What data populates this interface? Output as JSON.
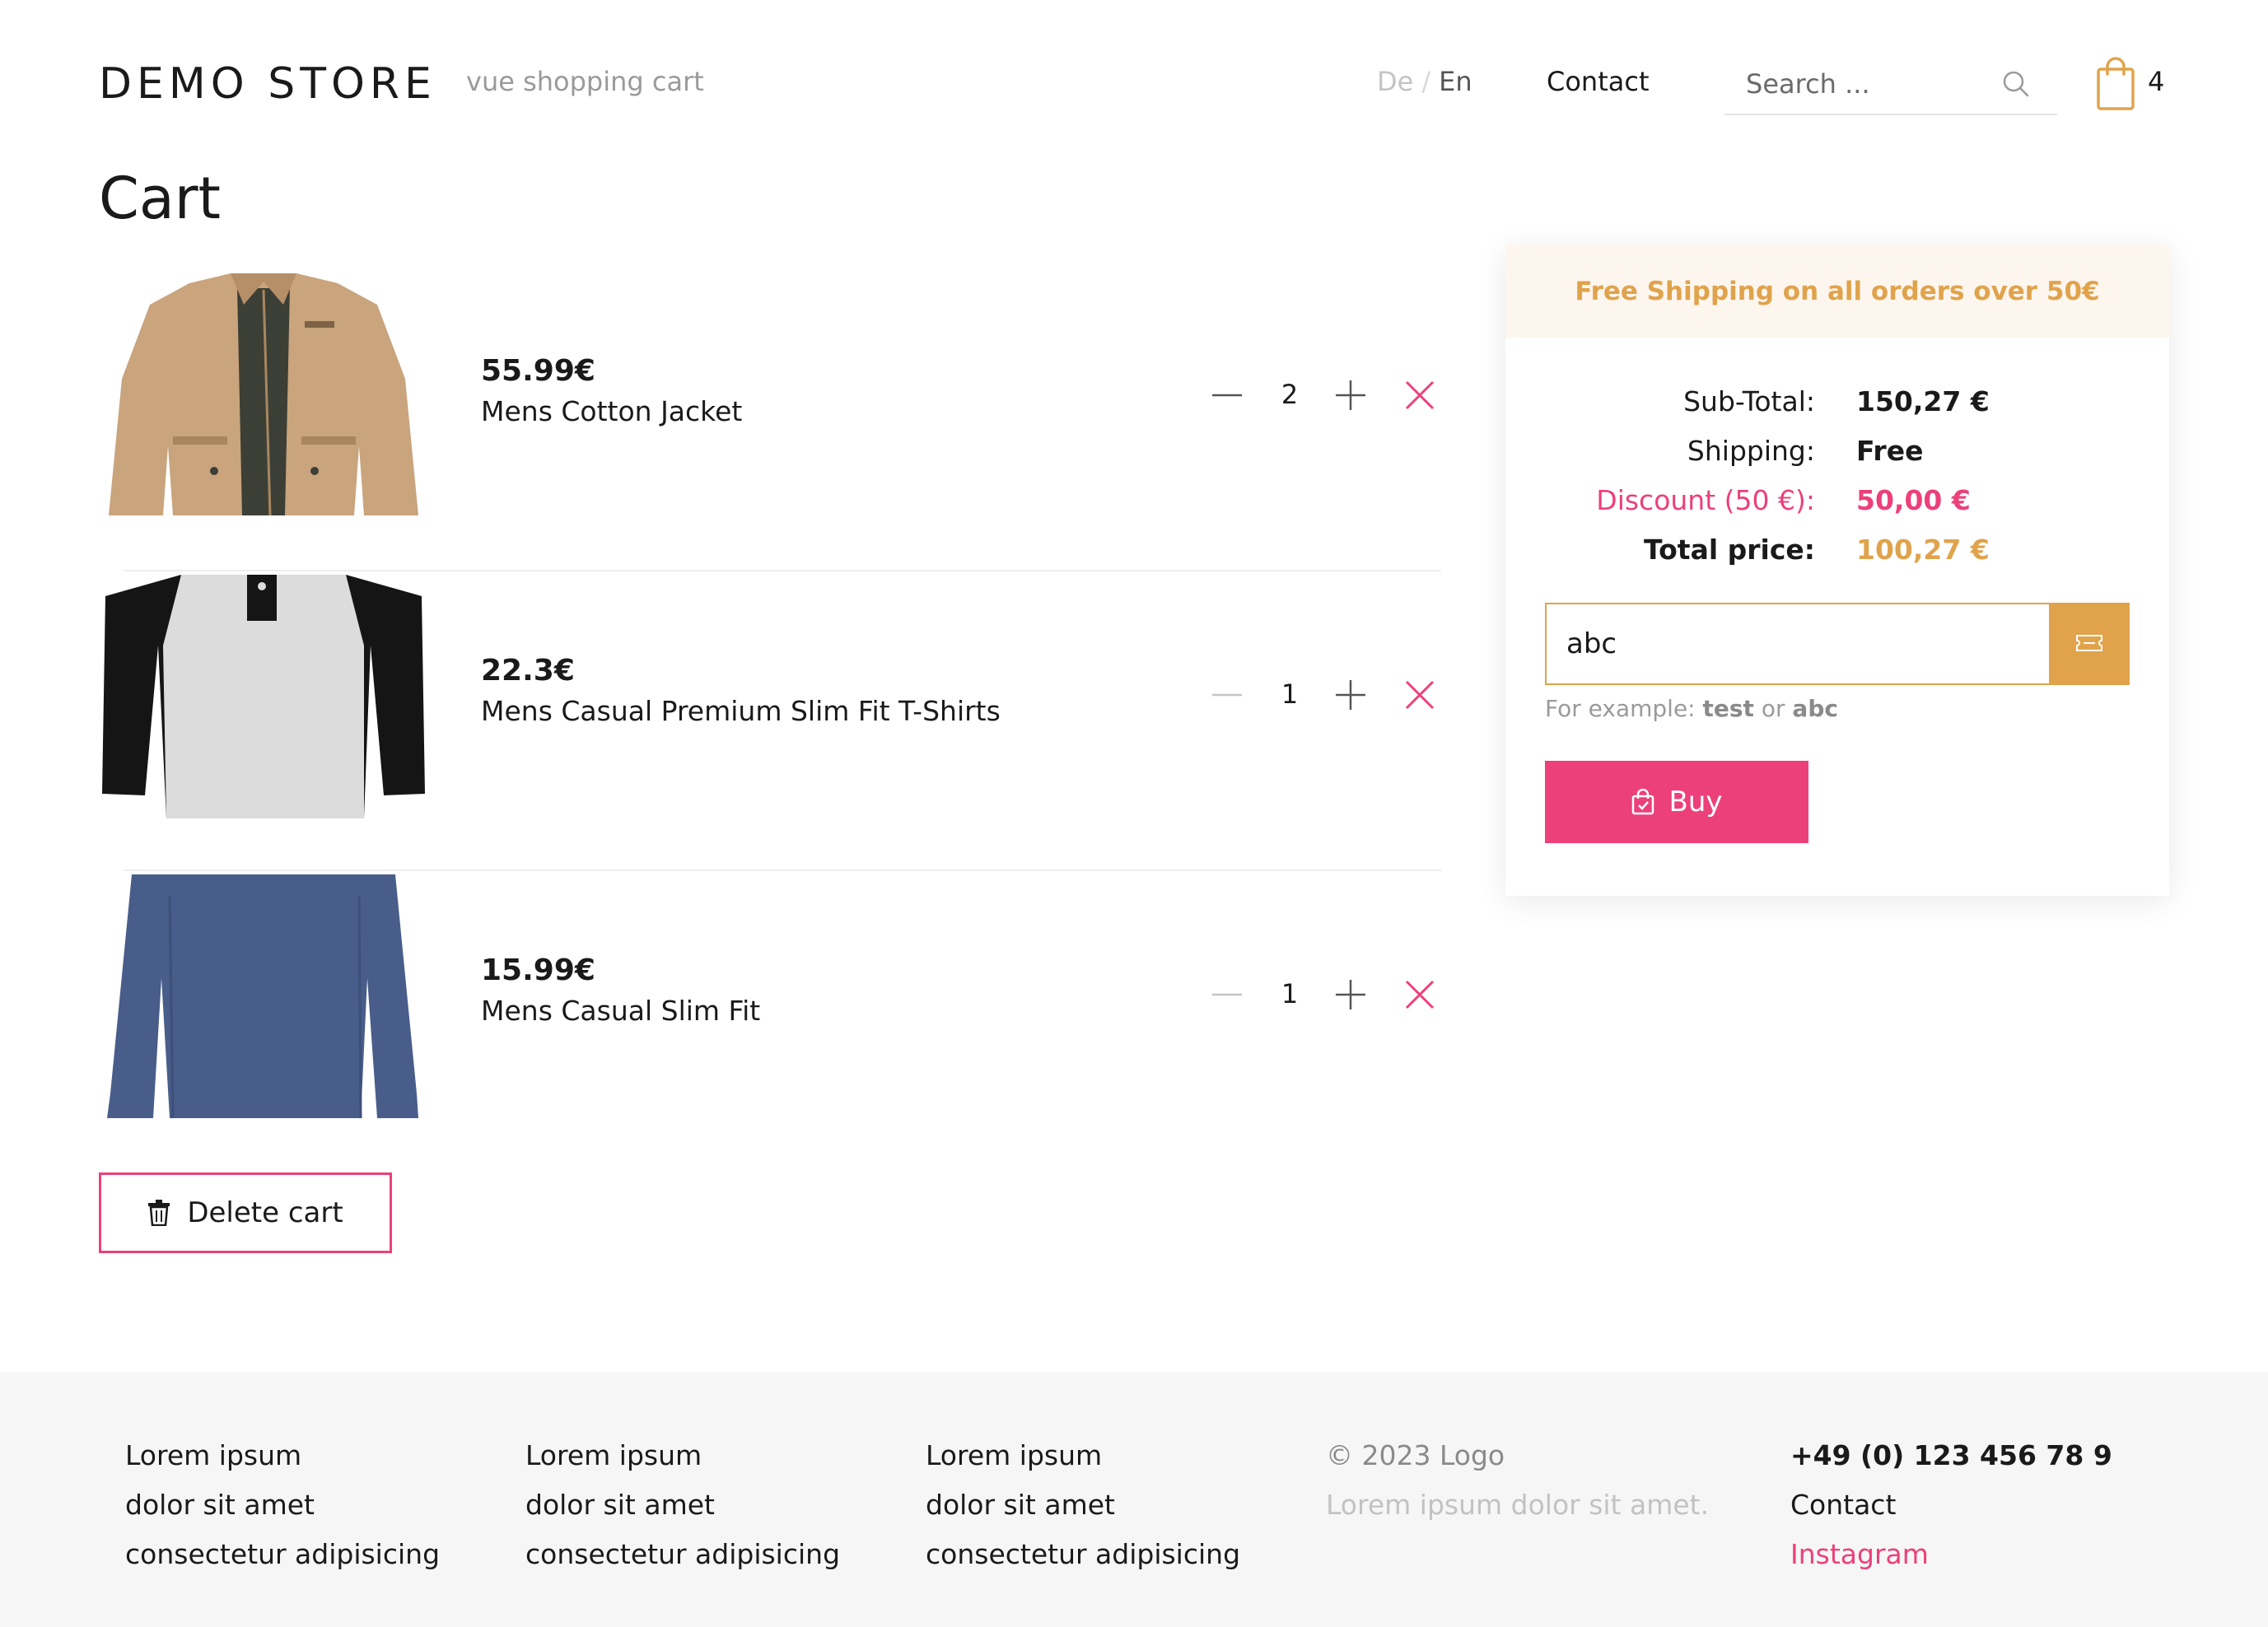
{
  "header": {
    "brand": "DEMO STORE",
    "tagline": "vue shopping cart",
    "lang_de": "De",
    "lang_sep": "/",
    "lang_en": "En",
    "contact": "Contact",
    "search_placeholder": "Search ...",
    "cart_count": "4"
  },
  "page_title": "Cart",
  "cart_items": [
    {
      "price": "55.99€",
      "name": "Mens Cotton Jacket",
      "qty": "2",
      "image": "jacket"
    },
    {
      "price": "22.3€",
      "name": "Mens Casual Premium Slim Fit T-Shirts",
      "qty": "1",
      "image": "raglan-tshirt"
    },
    {
      "price": "15.99€",
      "name": "Mens Casual Slim Fit",
      "qty": "1",
      "image": "longsleeve-shirt"
    }
  ],
  "delete_cart_label": "Delete cart",
  "summary": {
    "shipping_banner": "Free Shipping on all orders over 50€",
    "subtotal_label": "Sub-Total:",
    "subtotal_value": "150,27 €",
    "shipping_label": "Shipping:",
    "shipping_value": "Free",
    "discount_label": "Discount (50 €):",
    "discount_value": "50,00 €",
    "total_label": "Total price:",
    "total_value": "100,27 €",
    "coupon_value": "abc",
    "hint_prefix": "For example:",
    "hint_code1": "test",
    "hint_or": "or",
    "hint_code2": "abc",
    "buy_label": "Buy"
  },
  "footer": {
    "col1": [
      "Lorem ipsum",
      "dolor sit amet",
      "consectetur adipisicing"
    ],
    "col2": [
      "Lorem ipsum",
      "dolor sit amet",
      "consectetur adipisicing"
    ],
    "col3": [
      "Lorem ipsum",
      "dolor sit amet",
      "consectetur adipisicing"
    ],
    "copyright": "© 2023 Logo",
    "tagline": "Lorem ipsum dolor sit amet.",
    "phone": "+49 (0) 123 456 78 9",
    "contact": "Contact",
    "instagram": "Instagram"
  },
  "colors": {
    "accent_pink": "#ec407a",
    "accent_gold": "#e0a34c",
    "banner_bg": "#fdf6ee",
    "footer_bg": "#f6f6f6"
  },
  "icons": [
    "search-icon",
    "shopping-bag-icon",
    "minus-icon",
    "plus-icon",
    "close-icon",
    "trash-icon",
    "ticket-icon"
  ]
}
